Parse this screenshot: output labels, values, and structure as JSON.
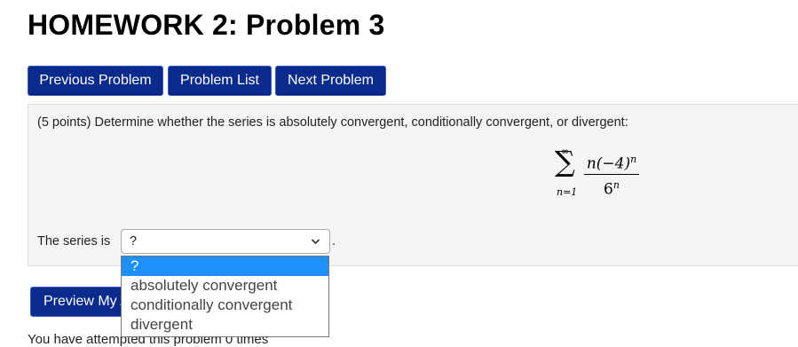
{
  "page": {
    "title": "HOMEWORK 2: Problem 3"
  },
  "nav": {
    "previous_label": "Previous Problem",
    "list_label": "Problem List",
    "next_label": "Next Problem"
  },
  "problem": {
    "prompt": "(5 points) Determine whether the series is absolutely convergent, conditionally convergent, or divergent:",
    "series": {
      "upper_limit": "∞",
      "lower_limit": "n=1",
      "numerator_base": "n(−4)",
      "numerator_exp": "n",
      "denominator_base": "6",
      "denominator_exp": "n"
    },
    "answer_label": "The series is",
    "selected_value": "?",
    "trailing_period": "."
  },
  "dropdown": {
    "options": [
      "?",
      "absolutely convergent",
      "conditionally convergent",
      "divergent"
    ],
    "highlighted_index": 0
  },
  "footer": {
    "preview_label": "Preview My Answers",
    "attempts_text": "You have attempted this problem 0 times"
  },
  "colors": {
    "button_bg": "#0a2a8c",
    "panel_bg": "#f4f4f4",
    "highlight": "#1e90ff"
  },
  "icons": {
    "select_arrow": "chevron-down-icon"
  }
}
